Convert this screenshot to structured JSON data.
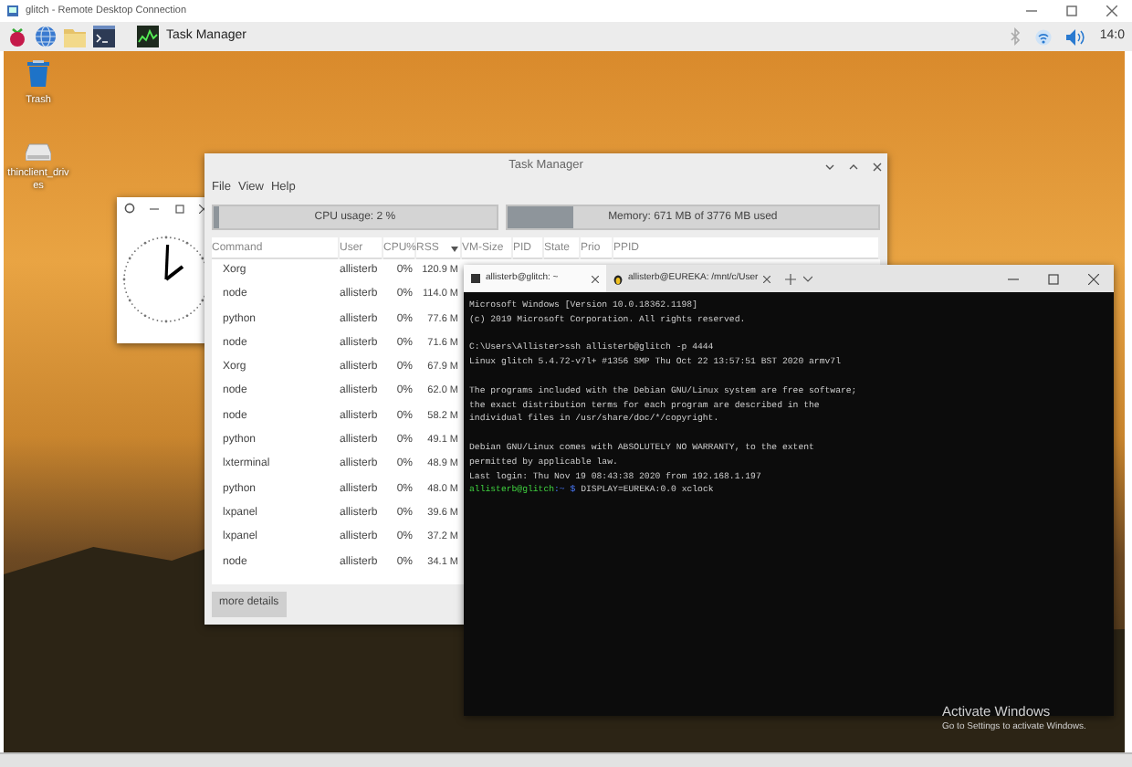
{
  "remote_window": {
    "title": "glitch - Remote Desktop Connection"
  },
  "taskbar": {
    "active_app": "Task Manager",
    "clock": "14:0"
  },
  "desktop_icons": [
    {
      "kind": "trash",
      "label": "Trash"
    },
    {
      "kind": "drive",
      "label": "thinclient_drives"
    }
  ],
  "task_manager": {
    "title": "Task Manager",
    "menu": [
      "File",
      "View",
      "Help"
    ],
    "cpu": {
      "text": "CPU usage: 2 %",
      "level": 0.02
    },
    "memory": {
      "text": "Memory: 671 MB of 3776 MB used",
      "level": 0.18
    },
    "columns": [
      {
        "label": "Command",
        "sorted": false
      },
      {
        "label": "User",
        "sorted": false
      },
      {
        "label": "CPU%",
        "sorted": false
      },
      {
        "label": "RSS",
        "sorted": true
      },
      {
        "label": "VM-Size",
        "sorted": false
      },
      {
        "label": "PID",
        "sorted": false
      },
      {
        "label": "State",
        "sorted": false
      },
      {
        "label": "Prio",
        "sorted": false
      },
      {
        "label": "PPID",
        "sorted": false
      }
    ],
    "rows": [
      [
        "Xorg",
        "allisterb",
        "0%",
        "120.9 M"
      ],
      [
        "node",
        "allisterb",
        "0%",
        "114.0 M"
      ],
      [
        "python",
        "allisterb",
        "0%",
        "77.6 M"
      ],
      [
        "node",
        "allisterb",
        "0%",
        "71.6 M"
      ],
      [
        "Xorg",
        "allisterb",
        "0%",
        "67.9 M"
      ],
      [
        "node",
        "allisterb",
        "0%",
        "62.0 M"
      ],
      [
        "node",
        "allisterb",
        "0%",
        "58.2 M"
      ],
      [
        "python",
        "allisterb",
        "0%",
        "49.1 M"
      ],
      [
        "lxterminal",
        "allisterb",
        "0%",
        "48.9 M"
      ],
      [
        "python",
        "allisterb",
        "0%",
        "48.0 M"
      ],
      [
        "lxpanel",
        "allisterb",
        "0%",
        "39.6 M"
      ],
      [
        "lxpanel",
        "allisterb",
        "0%",
        "37.2 M"
      ],
      [
        "node",
        "allisterb",
        "0%",
        "34.1 M"
      ]
    ],
    "more_details": "more details"
  },
  "terminal": {
    "tabs": [
      {
        "title": "allisterb@glitch: ~",
        "kind": "shell",
        "selected": true
      },
      {
        "title": "allisterb@EUREKA: /mnt/c/User",
        "kind": "linux",
        "selected": false
      }
    ],
    "lines": [
      {
        "kind": "plain",
        "text": "Microsoft Windows [Version 10.0.18362.1198]"
      },
      {
        "kind": "plain",
        "text": "(c) 2019 Microsoft Corporation. All rights reserved."
      },
      {
        "kind": "blank"
      },
      {
        "kind": "plain",
        "text": "C:\\Users\\Allister>ssh allisterb@glitch -p 4444"
      },
      {
        "kind": "plain",
        "text": "Linux glitch 5.4.72-v7l+ #1356 SMP Thu Oct 22 13:57:51 BST 2020 armv7l"
      },
      {
        "kind": "blank"
      },
      {
        "kind": "plain",
        "text": "The programs included with the Debian GNU/Linux system are free software;"
      },
      {
        "kind": "plain",
        "text": "the exact distribution terms for each program are described in the"
      },
      {
        "kind": "plain",
        "text": "individual files in /usr/share/doc/*/copyright."
      },
      {
        "kind": "blank"
      },
      {
        "kind": "plain",
        "text": "Debian GNU/Linux comes with ABSOLUTELY NO WARRANTY, to the extent"
      },
      {
        "kind": "plain",
        "text": "permitted by applicable law."
      },
      {
        "kind": "plain",
        "text": "Last login: Thu Nov 19 08:43:38 2020 from 192.168.1.197"
      },
      {
        "kind": "prompt",
        "user_host": "allisterb@glitch",
        "path": ":~",
        "symbol": "$",
        "command": "DISPLAY=EUREKA:0.0 xclock"
      }
    ]
  },
  "activation_notice": {
    "title": "Activate Windows",
    "subtitle": "Go to Settings to activate Windows."
  }
}
